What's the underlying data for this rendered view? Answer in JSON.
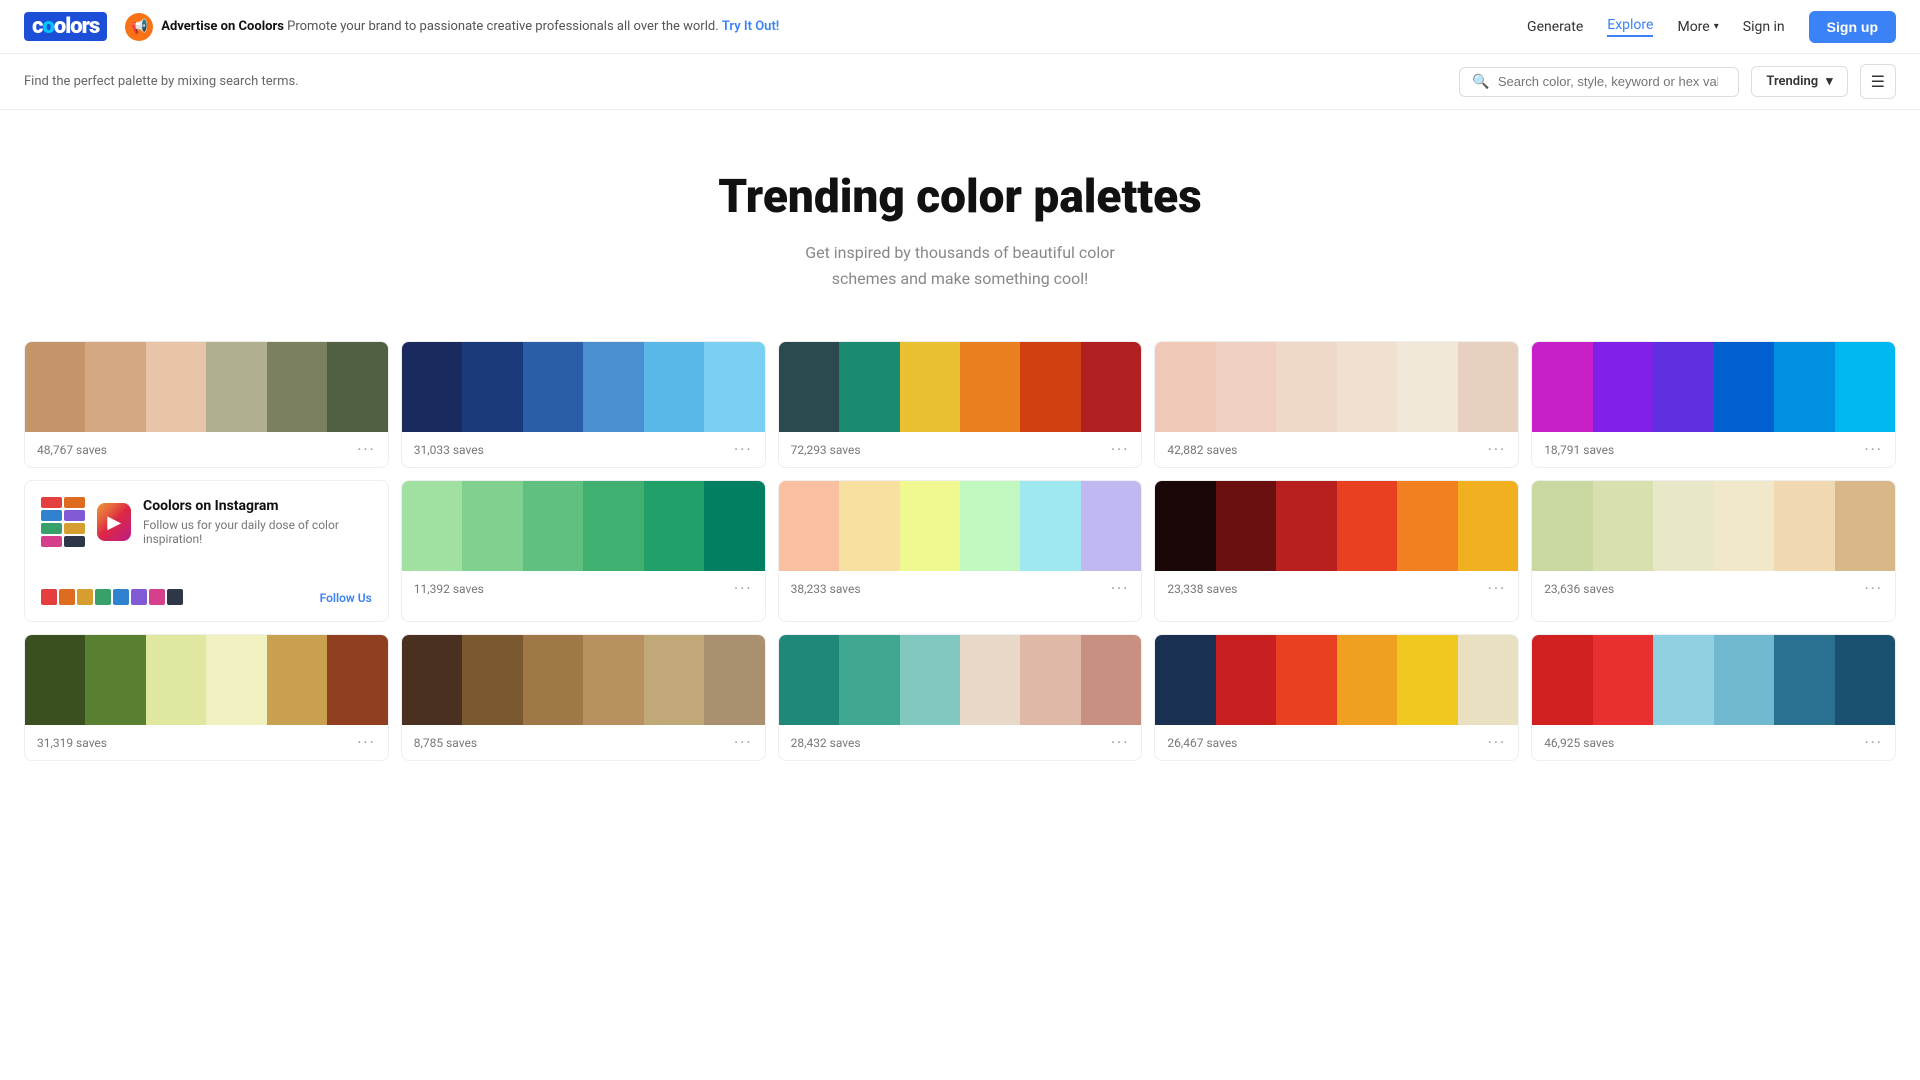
{
  "navbar": {
    "logo": "coolors",
    "ad": {
      "title": "Advertise on Coolors",
      "desc": "Promote your brand to passionate creative professionals all over the world.",
      "cta": "Try It Out!"
    },
    "links": [
      {
        "label": "Generate",
        "active": false
      },
      {
        "label": "Explore",
        "active": true
      },
      {
        "label": "More",
        "active": false
      }
    ],
    "sign_in": "Sign in",
    "sign_up": "Sign up"
  },
  "search": {
    "tagline": "Find the perfect palette by mixing search terms.",
    "placeholder": "Search color, style, keyword or hex value",
    "sort_label": "Trending"
  },
  "hero": {
    "title": "Trending color palettes",
    "subtitle": "Get inspired by thousands of beautiful color\nschemes and make something cool!"
  },
  "instagram": {
    "title": "Coolors on Instagram",
    "desc": "Follow us for your daily dose of color inspiration!",
    "cta": "Follow Us",
    "top_colors": [
      "#e53e3e",
      "#dd6b20",
      "#d69e2e",
      "#38a169",
      "#3182ce",
      "#805ad5",
      "#d53f8c",
      "#2d3748"
    ],
    "bottom_colors": [
      "#e53e3e",
      "#dd6b20",
      "#d69e2e",
      "#38a169",
      "#3182ce",
      "#805ad5"
    ]
  },
  "palettes": [
    {
      "id": "p1",
      "saves": "48,767 saves",
      "colors": [
        "#c4956a",
        "#d4a882",
        "#e8c4a8",
        "#b0b090",
        "#7a8060",
        "#506040"
      ]
    },
    {
      "id": "p2",
      "saves": "31,033 saves",
      "colors": [
        "#1a2a5e",
        "#1a3a7a",
        "#2a5ea8",
        "#4a90d0",
        "#5ab8e8",
        "#7ad0f0"
      ]
    },
    {
      "id": "p3",
      "saves": "72,293 saves",
      "colors": [
        "#2a4a50",
        "#1a8a70",
        "#e8c030",
        "#e88020",
        "#d04010",
        "#b02020"
      ]
    },
    {
      "id": "p4",
      "saves": "42,882 saves",
      "colors": [
        "#f0c8b8",
        "#f0d0c0",
        "#f0d8c8",
        "#f0e0d0",
        "#f0e8d8",
        "#e8d0c0"
      ]
    },
    {
      "id": "p5",
      "saves": "18,791 saves",
      "colors": [
        "#c820c8",
        "#8020e8",
        "#6030e0",
        "#0060d0",
        "#0090e0",
        "#00b8f0"
      ]
    },
    {
      "id": "p6",
      "saves": "11,392 saves",
      "colors": [
        "#a0e0a0",
        "#80d090",
        "#60c080",
        "#40b070",
        "#20a068",
        "#008060"
      ]
    },
    {
      "id": "p7",
      "saves": "38,233 saves",
      "colors": [
        "#f8c0a0",
        "#f8e0a0",
        "#f0f890",
        "#c0f8c0",
        "#a0e8f0",
        "#c0b8f0"
      ]
    },
    {
      "id": "p8",
      "saves": "23,338 saves",
      "colors": [
        "#1a0808",
        "#6a1010",
        "#b82020",
        "#e84020",
        "#f08020",
        "#f0b020"
      ]
    },
    {
      "id": "p9",
      "saves": "23,636 saves",
      "colors": [
        "#c8d8a0",
        "#d8e0b0",
        "#e8e8c8",
        "#f0e8c8",
        "#f0d8b0",
        "#d8b888"
      ]
    },
    {
      "id": "p10",
      "saves": "31,319 saves",
      "colors": [
        "#3a5020",
        "#588030",
        "#e0e8a0",
        "#f0f0c0",
        "#c8a050",
        "#904020"
      ]
    },
    {
      "id": "p11",
      "saves": "8,785 saves",
      "colors": [
        "#4a3020",
        "#7a5830",
        "#a07848",
        "#b89060",
        "#c0a878",
        "#a89070"
      ]
    },
    {
      "id": "p12",
      "saves": "28,432 saves",
      "colors": [
        "#208878",
        "#40a890",
        "#80c8c0",
        "#e8d8c8",
        "#e0b8a8",
        "#c89080"
      ]
    },
    {
      "id": "p13",
      "saves": "26,467 saves",
      "colors": [
        "#1a3050",
        "#c82020",
        "#e84020",
        "#f0a020",
        "#f0c820",
        "#e8e0c0"
      ]
    },
    {
      "id": "p14",
      "saves": "46,925 saves",
      "colors": [
        "#d02020",
        "#e83030",
        "#90d0e0",
        "#70b8d0",
        "#2a7090",
        "#1a5070"
      ]
    }
  ]
}
